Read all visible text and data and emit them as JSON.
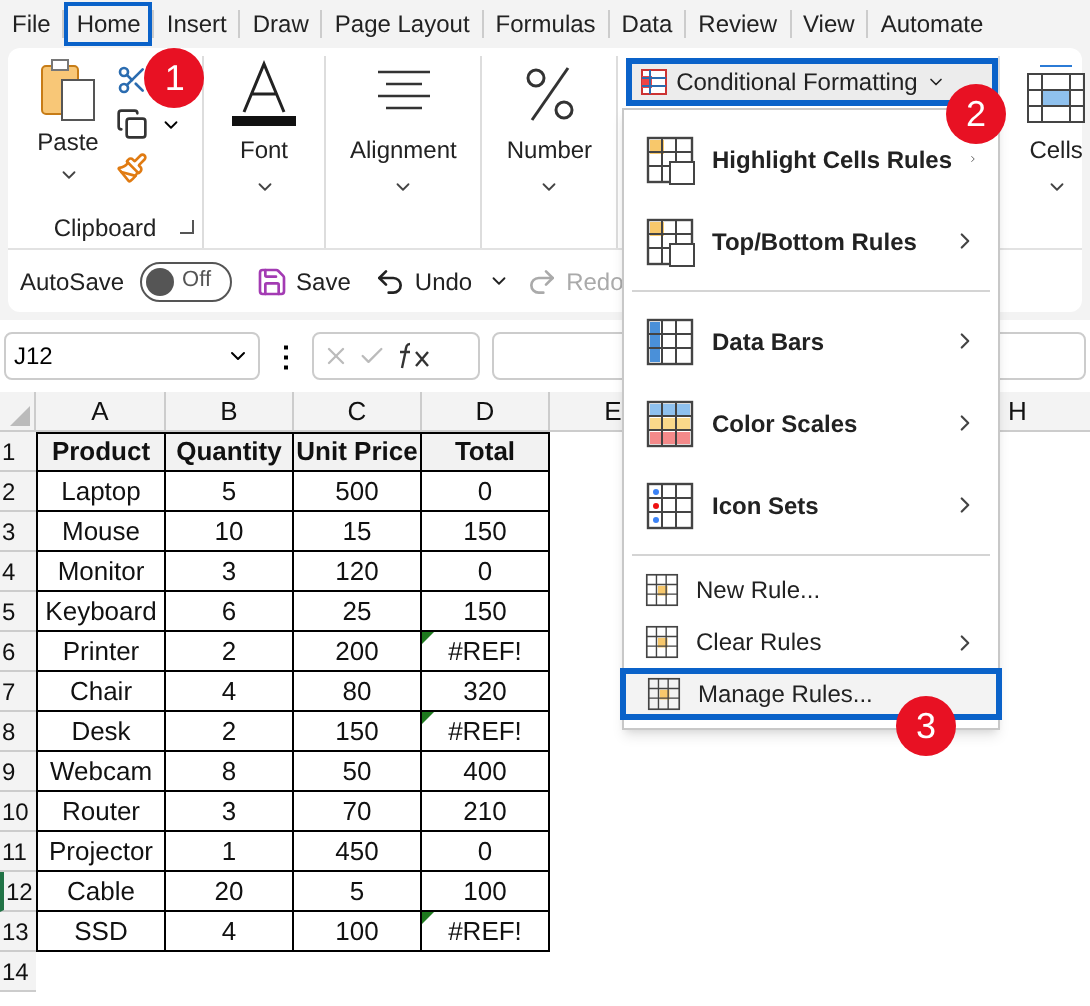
{
  "tabs": [
    {
      "label": "File",
      "selected": false
    },
    {
      "label": "Home",
      "selected": true,
      "callout": "1"
    },
    {
      "label": "Insert",
      "selected": false
    },
    {
      "label": "Draw",
      "selected": false
    },
    {
      "label": "Page Layout",
      "selected": false
    },
    {
      "label": "Formulas",
      "selected": false
    },
    {
      "label": "Data",
      "selected": false
    },
    {
      "label": "Review",
      "selected": false
    },
    {
      "label": "View",
      "selected": false
    },
    {
      "label": "Automate",
      "selected": false
    }
  ],
  "ribbon": {
    "clipboard": {
      "paste": "Paste",
      "group": "Clipboard"
    },
    "groups": [
      {
        "label": "Font"
      },
      {
        "label": "Alignment"
      },
      {
        "label": "Number"
      }
    ],
    "conditional_formatting": {
      "label": "Conditional Formatting",
      "highlighted": true,
      "callout": "2"
    },
    "cells": {
      "label": "Cells"
    }
  },
  "quick_access": {
    "autosave": "AutoSave",
    "autosave_on": false,
    "autosave_state": "Off",
    "save": "Save",
    "undo": "Undo",
    "redo": "Redo",
    "redo_disabled": true
  },
  "formula_bar": {
    "name_box": "J12",
    "more": "⋮"
  },
  "menu": {
    "items": [
      {
        "kind": "large",
        "label": "Highlight Cells Rules",
        "submenu": true,
        "highlighted": false
      },
      {
        "kind": "large",
        "label": "Top/Bottom Rules",
        "submenu": true,
        "highlighted": false
      },
      {
        "kind": "separator"
      },
      {
        "kind": "large",
        "label": "Data Bars",
        "submenu": true,
        "highlighted": false
      },
      {
        "kind": "large",
        "label": "Color Scales",
        "submenu": true,
        "highlighted": false
      },
      {
        "kind": "large",
        "label": "Icon Sets",
        "submenu": true,
        "highlighted": false
      },
      {
        "kind": "separator"
      },
      {
        "kind": "small",
        "label": "New Rule...",
        "submenu": false,
        "highlighted": false
      },
      {
        "kind": "small",
        "label": "Clear Rules",
        "submenu": true,
        "highlighted": false
      },
      {
        "kind": "small",
        "label": "Manage Rules...",
        "submenu": false,
        "highlighted": true,
        "callout": "3"
      }
    ]
  },
  "sheet": {
    "columns": [
      "A",
      "B",
      "C",
      "D",
      "E"
    ],
    "columns_right": [
      "H"
    ],
    "rows": [
      {
        "number": "1",
        "selected": false,
        "header": true,
        "cells": [
          {
            "value": "Product",
            "error": false
          },
          {
            "value": "Quantity",
            "error": false
          },
          {
            "value": "Unit Price",
            "error": false
          },
          {
            "value": "Total",
            "error": false
          }
        ]
      },
      {
        "number": "2",
        "selected": false,
        "header": false,
        "cells": [
          {
            "value": "Laptop",
            "error": false
          },
          {
            "value": "5",
            "error": false
          },
          {
            "value": "500",
            "error": false
          },
          {
            "value": "0",
            "error": false
          }
        ]
      },
      {
        "number": "3",
        "selected": false,
        "header": false,
        "cells": [
          {
            "value": "Mouse",
            "error": false
          },
          {
            "value": "10",
            "error": false
          },
          {
            "value": "15",
            "error": false
          },
          {
            "value": "150",
            "error": false
          }
        ]
      },
      {
        "number": "4",
        "selected": false,
        "header": false,
        "cells": [
          {
            "value": "Monitor",
            "error": false
          },
          {
            "value": "3",
            "error": false
          },
          {
            "value": "120",
            "error": false
          },
          {
            "value": "0",
            "error": false
          }
        ]
      },
      {
        "number": "5",
        "selected": false,
        "header": false,
        "cells": [
          {
            "value": "Keyboard",
            "error": false
          },
          {
            "value": "6",
            "error": false
          },
          {
            "value": "25",
            "error": false
          },
          {
            "value": "150",
            "error": false
          }
        ]
      },
      {
        "number": "6",
        "selected": false,
        "header": false,
        "cells": [
          {
            "value": "Printer",
            "error": false
          },
          {
            "value": "2",
            "error": false
          },
          {
            "value": "200",
            "error": false
          },
          {
            "value": "#REF!",
            "error": true
          }
        ]
      },
      {
        "number": "7",
        "selected": false,
        "header": false,
        "cells": [
          {
            "value": "Chair",
            "error": false
          },
          {
            "value": "4",
            "error": false
          },
          {
            "value": "80",
            "error": false
          },
          {
            "value": "320",
            "error": false
          }
        ]
      },
      {
        "number": "8",
        "selected": false,
        "header": false,
        "cells": [
          {
            "value": "Desk",
            "error": false
          },
          {
            "value": "2",
            "error": false
          },
          {
            "value": "150",
            "error": false
          },
          {
            "value": "#REF!",
            "error": true
          }
        ]
      },
      {
        "number": "9",
        "selected": false,
        "header": false,
        "cells": [
          {
            "value": "Webcam",
            "error": false
          },
          {
            "value": "8",
            "error": false
          },
          {
            "value": "50",
            "error": false
          },
          {
            "value": "400",
            "error": false
          }
        ]
      },
      {
        "number": "10",
        "selected": false,
        "header": false,
        "cells": [
          {
            "value": "Router",
            "error": false
          },
          {
            "value": "3",
            "error": false
          },
          {
            "value": "70",
            "error": false
          },
          {
            "value": "210",
            "error": false
          }
        ]
      },
      {
        "number": "11",
        "selected": false,
        "header": false,
        "cells": [
          {
            "value": "Projector",
            "error": false
          },
          {
            "value": "1",
            "error": false
          },
          {
            "value": "450",
            "error": false
          },
          {
            "value": "0",
            "error": false
          }
        ]
      },
      {
        "number": "12",
        "selected": true,
        "header": false,
        "cells": [
          {
            "value": "Cable",
            "error": false
          },
          {
            "value": "20",
            "error": false
          },
          {
            "value": "5",
            "error": false
          },
          {
            "value": "100",
            "error": false
          }
        ]
      },
      {
        "number": "13",
        "selected": false,
        "header": false,
        "cells": [
          {
            "value": "SSD",
            "error": false
          },
          {
            "value": "4",
            "error": false
          },
          {
            "value": "100",
            "error": false
          },
          {
            "value": "#REF!",
            "error": true
          }
        ]
      },
      {
        "number": "14",
        "selected": false,
        "cells": []
      }
    ]
  }
}
